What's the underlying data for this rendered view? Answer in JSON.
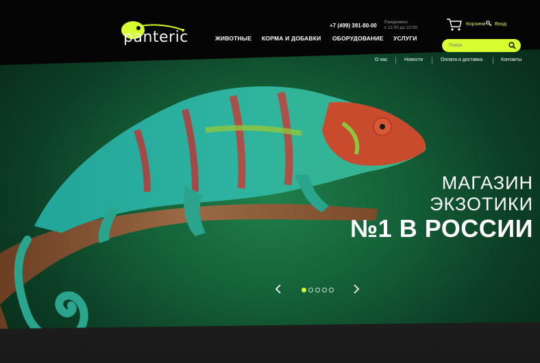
{
  "brand": {
    "name": "panteric",
    "accent": "#d7ff2f"
  },
  "contact": {
    "phone": "+7 (499) 391-80-00",
    "hours_line1": "Ежедневно",
    "hours_line2": "с 11:00 до 22:00"
  },
  "user": {
    "cart_label": "Корзина",
    "login_label": "Вход"
  },
  "nav": {
    "items": [
      "ЖИВОТНЫЕ",
      "КОРМА И ДОБАВКИ",
      "ОБОРУДОВАНИЕ",
      "УСЛУГИ"
    ]
  },
  "search": {
    "placeholder": "Поиск"
  },
  "subnav": {
    "items": [
      "О нас",
      "Новости",
      "Оплата и доставка",
      "Контакты"
    ]
  },
  "hero": {
    "line1": "МАГАЗИН",
    "line2": "ЭКЗОТИКИ",
    "line3": "№1 В РОССИИ",
    "slides_total": 5,
    "slide_active": 1
  }
}
